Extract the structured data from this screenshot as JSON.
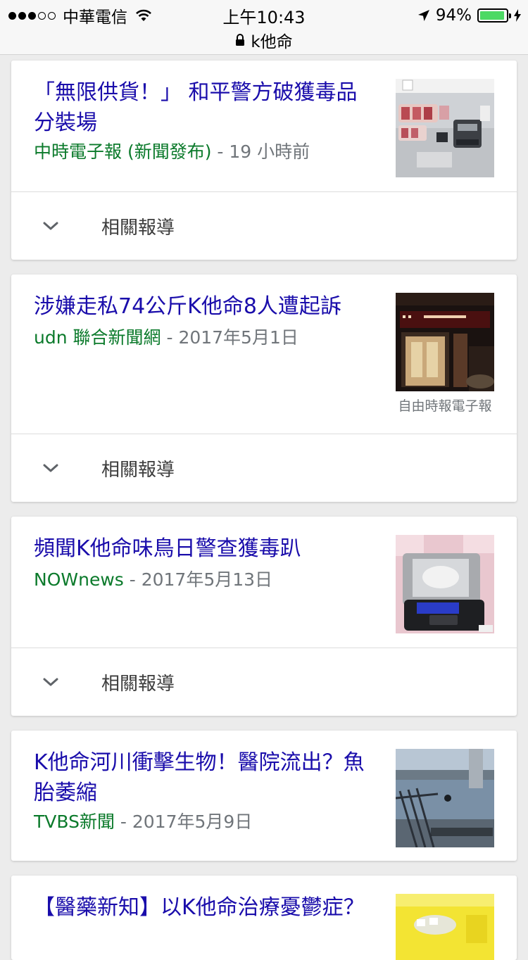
{
  "status_bar": {
    "carrier": "中華電信",
    "time": "上午10:43",
    "url": "k他命",
    "battery_text": "94%",
    "battery_level": 0.94,
    "signal_bars": 3
  },
  "results": [
    {
      "title": "「無限供貨！」 和平警方破獲毒品分裝場",
      "source": "中時電子報 (新聞發布)",
      "separator": " - ",
      "time": "19 小時前",
      "related_label": "相關報導"
    },
    {
      "title": "涉嫌走私74公斤K他命8人遭起訴",
      "source": "udn 聯合新聞網",
      "separator": " - ",
      "time": "2017年5月1日",
      "thumb_caption": "自由時報電子報",
      "related_label": "相關報導"
    },
    {
      "title": "頻聞K他命味鳥日警查獲毒趴",
      "source": "NOWnews",
      "separator": " - ",
      "time": "2017年5月13日",
      "related_label": "相關報導"
    },
    {
      "title": "K他命河川衝擊生物！醫院流出？魚胎萎縮",
      "source": "TVBS新聞",
      "separator": " - ",
      "time": "2017年5月9日"
    },
    {
      "title": "【醫藥新知】以K他命治療憂鬱症？"
    }
  ],
  "colors": {
    "title": "#1a0dab",
    "source": "#0b7a2b",
    "muted": "#70757a",
    "battery": "#4cd964"
  }
}
